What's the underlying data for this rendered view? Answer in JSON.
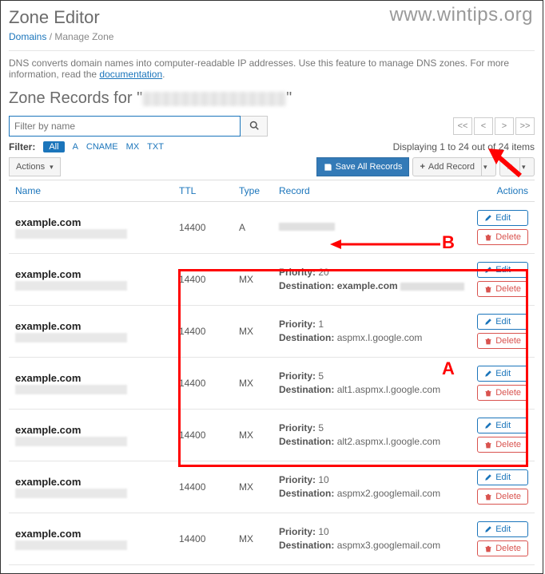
{
  "watermark": "www.wintips.org",
  "page_title": "Zone Editor",
  "breadcrumbs": {
    "root": "Domains",
    "current": "Manage Zone"
  },
  "description_pre": "DNS converts domain names into computer-readable IP addresses. Use this feature to manage DNS zones. For more information, read the ",
  "description_link": "documentation",
  "subheader_prefix": "Zone Records for \"",
  "subheader_suffix": "\"",
  "search": {
    "placeholder": "Filter by name"
  },
  "pager": {
    "first": "<<",
    "prev": "<",
    "next": ">",
    "last": ">>"
  },
  "filter_label": "Filter:",
  "filters": [
    "All",
    "A",
    "CNAME",
    "MX",
    "TXT"
  ],
  "display_status": "Displaying 1 to 24 out of 24 items",
  "actions_dropdown": "Actions",
  "save_all": "Save All Records",
  "add_record": "Add Record",
  "columns": {
    "name": "Name",
    "ttl": "TTL",
    "type": "Type",
    "record": "Record",
    "actions": "Actions"
  },
  "labels": {
    "priority": "Priority:",
    "destination": "Destination:",
    "edit": "Edit",
    "delete": "Delete"
  },
  "rows": [
    {
      "name": "example.com",
      "ttl": "14400",
      "type": "A",
      "record_blur": true
    },
    {
      "name": "example.com",
      "ttl": "14400",
      "type": "MX",
      "priority": "20",
      "dest": "example.com ",
      "dest_blur": true
    },
    {
      "name": "example.com",
      "ttl": "14400",
      "type": "MX",
      "priority": "1",
      "dest": "aspmx.l.google.com"
    },
    {
      "name": "example.com",
      "ttl": "14400",
      "type": "MX",
      "priority": "5",
      "dest": "alt1.aspmx.l.google.com"
    },
    {
      "name": "example.com",
      "ttl": "14400",
      "type": "MX",
      "priority": "5",
      "dest": "alt2.aspmx.l.google.com"
    },
    {
      "name": "example.com",
      "ttl": "14400",
      "type": "MX",
      "priority": "10",
      "dest": "aspmx2.googlemail.com"
    },
    {
      "name": "example.com",
      "ttl": "14400",
      "type": "MX",
      "priority": "10",
      "dest": "aspmx3.googlemail.com"
    }
  ],
  "annotations": {
    "A": "A",
    "B": "B"
  }
}
